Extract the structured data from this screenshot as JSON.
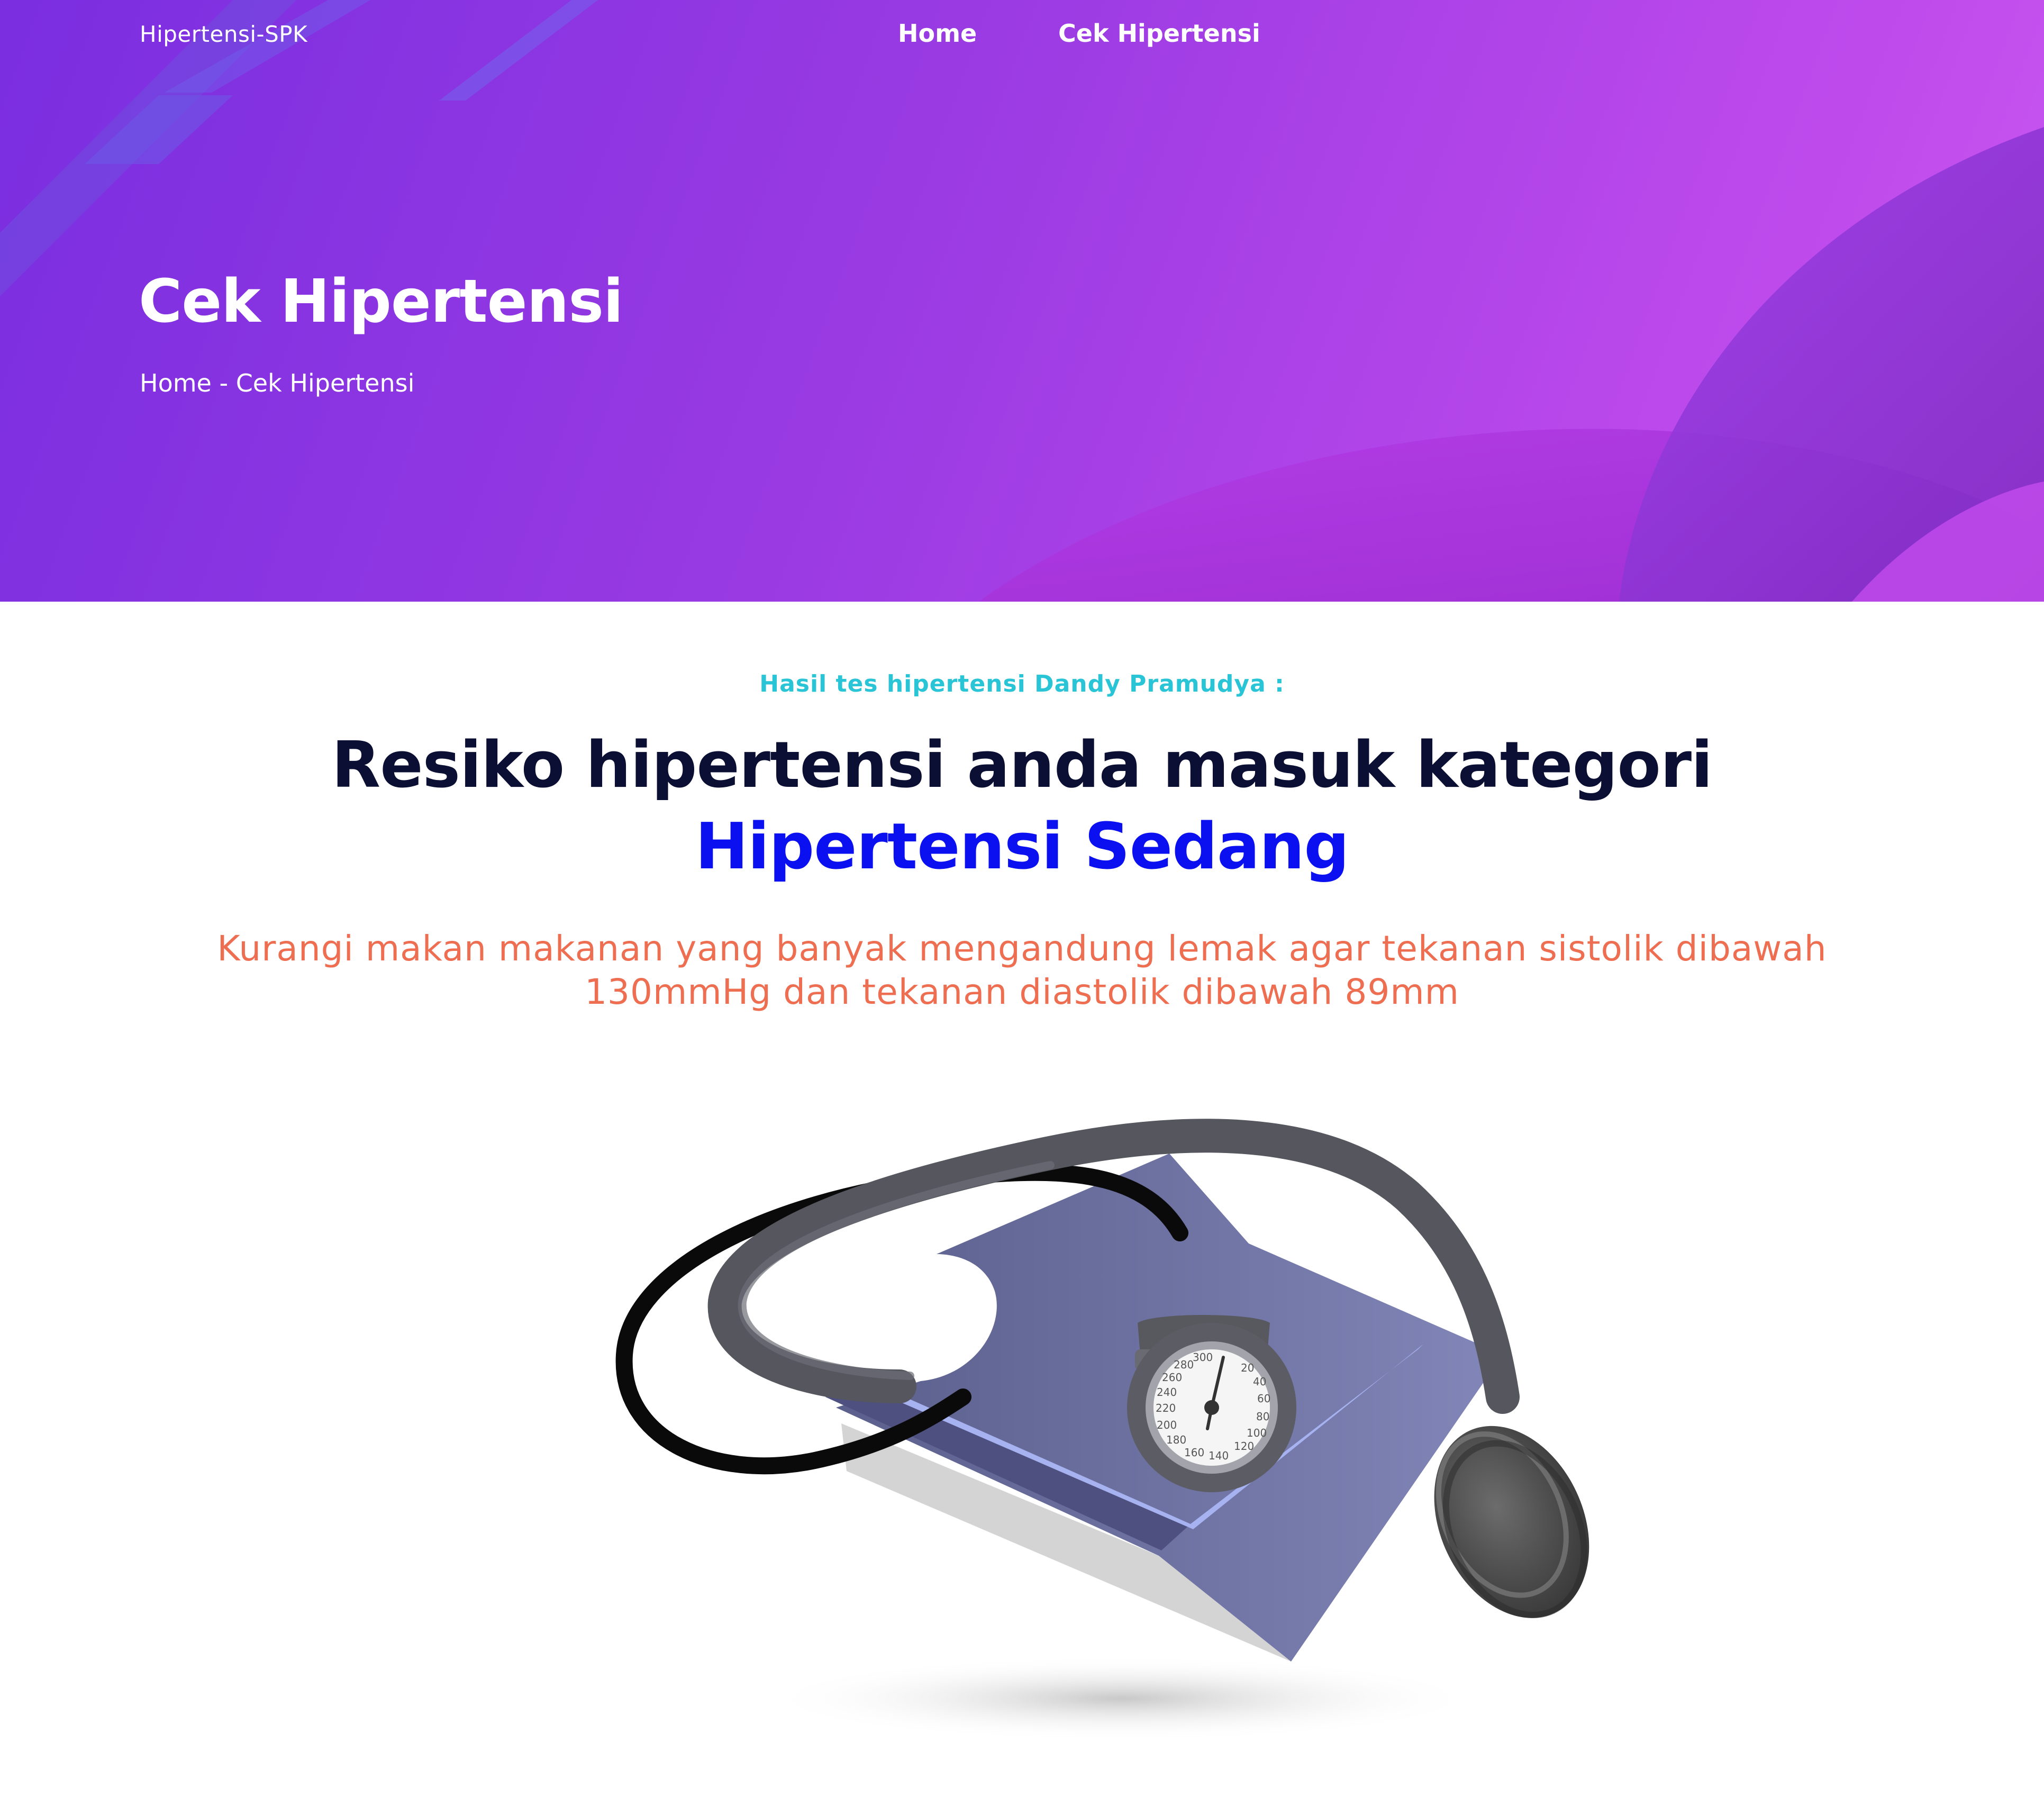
{
  "navbar": {
    "brand": "Hipertensi-SPK",
    "links": [
      "Home",
      "Cek Hipertensi"
    ]
  },
  "hero": {
    "title": "Cek Hipertensi",
    "breadcrumb": {
      "home": "Home",
      "separator": " - ",
      "current": "Cek Hipertensi"
    }
  },
  "result": {
    "subtitle": "Hasil tes hipertensi Dandy Pramudya :",
    "headline_prefix": "Resiko hipertensi anda masuk kategori ",
    "category": "Hipertensi Sedang",
    "advice": "Kurangi makan makanan yang banyak mengandung lemak agar tekanan sistolik dibawah 130mmHg dan tekanan diastolik dibawah 89mm"
  },
  "gauge": {
    "scale": [
      "20",
      "40",
      "60",
      "80",
      "100",
      "120",
      "140",
      "160",
      "180",
      "200",
      "220",
      "240",
      "260",
      "280",
      "300"
    ]
  },
  "colors": {
    "hero_start": "#7a2ee0",
    "hero_end": "#c95af0",
    "subtitle": "#29c4d6",
    "headline": "#0b0f33",
    "category": "#0a10f0",
    "advice": "#ee6e52"
  },
  "icons": {
    "illustration": "blood-pressure-monitor-icon"
  }
}
